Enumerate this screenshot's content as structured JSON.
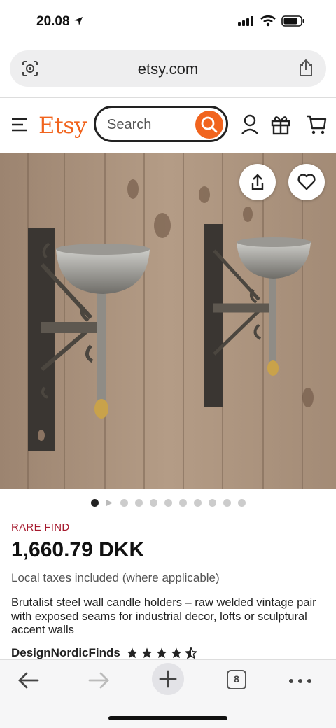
{
  "status": {
    "time": "20.08"
  },
  "browser": {
    "url": "etsy.com",
    "tab_count": "8"
  },
  "header": {
    "logo": "Etsy",
    "search_placeholder": "Search"
  },
  "gallery": {
    "image_count": 11,
    "current_index": 0
  },
  "listing": {
    "badge": "RARE FIND",
    "price": "1,660.79 DKK",
    "tax_note": "Local taxes included (where applicable)",
    "title": "Brutalist steel wall candle holders – raw welded vintage pair with exposed seams for industrial decor, lofts or sculptural accent walls",
    "shop_name": "DesignNordicFinds",
    "rating": 4.5
  },
  "colors": {
    "brand": "#f1641e",
    "badge": "#a61a2e"
  },
  "icons": [
    "location-arrow-icon",
    "signal-icon",
    "wifi-icon",
    "battery-icon",
    "page-settings-icon",
    "share-icon",
    "menu-icon",
    "search-icon",
    "account-icon",
    "gift-icon",
    "cart-icon",
    "heart-icon",
    "star-icon",
    "back-icon",
    "forward-icon",
    "plus-icon",
    "tabs-icon",
    "more-icon"
  ]
}
